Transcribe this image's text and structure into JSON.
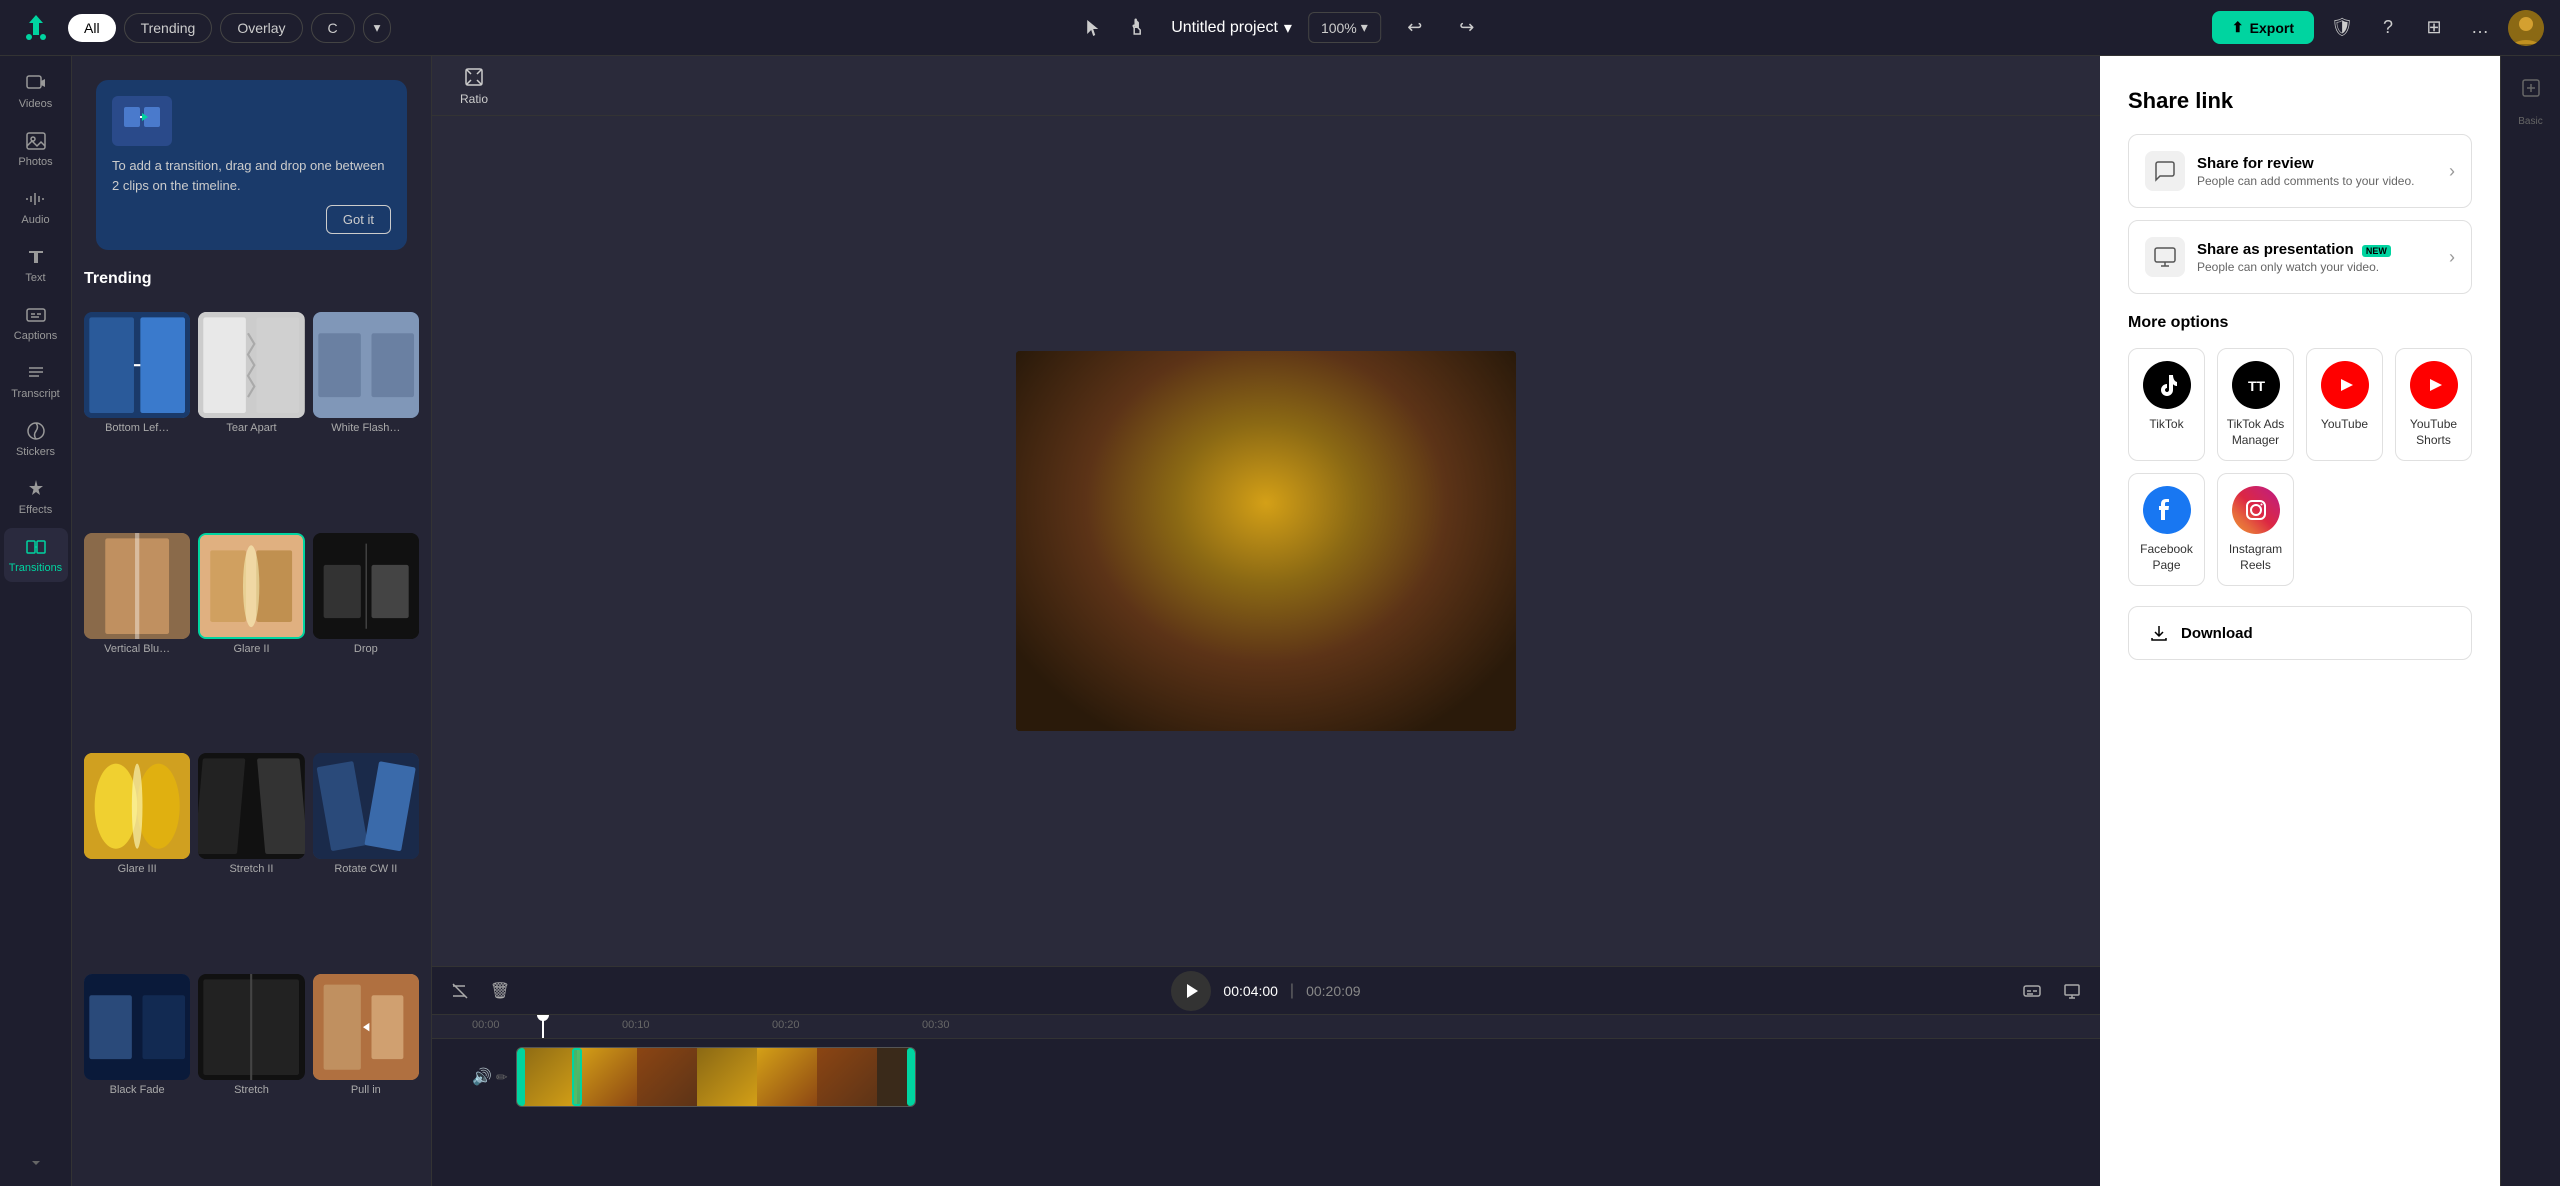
{
  "header": {
    "logo": "✂",
    "filters": {
      "all_label": "All",
      "trending_label": "Trending",
      "overlay_label": "Overlay",
      "c_label": "C",
      "dropdown_label": "▾"
    },
    "project_title": "Untitled project",
    "project_dropdown": "▾",
    "zoom_level": "100%",
    "zoom_dropdown": "▾",
    "undo_label": "↩",
    "redo_label": "↪",
    "export_label": "Export",
    "export_icon": "⬆",
    "shield_icon": "🛡",
    "question_icon": "?",
    "grid_icon": "⊞",
    "more_icon": "…"
  },
  "sidebar": {
    "items": [
      {
        "id": "videos",
        "icon": "▶",
        "label": "Videos"
      },
      {
        "id": "photos",
        "icon": "🖼",
        "label": "Photos"
      },
      {
        "id": "audio",
        "icon": "♪",
        "label": "Audio"
      },
      {
        "id": "text",
        "icon": "T",
        "label": "Text"
      },
      {
        "id": "captions",
        "icon": "CC",
        "label": "Captions"
      },
      {
        "id": "transcript",
        "icon": "≡",
        "label": "Transcript"
      },
      {
        "id": "stickers",
        "icon": "★",
        "label": "Stickers"
      },
      {
        "id": "effects",
        "icon": "✦",
        "label": "Effects"
      },
      {
        "id": "transitions",
        "icon": "⇄",
        "label": "Transitions"
      }
    ]
  },
  "transitions_panel": {
    "tooltip": {
      "text": "To add a transition, drag and drop one between 2 clips on the timeline.",
      "got_it_label": "Got it"
    },
    "section_title": "Trending",
    "items": [
      {
        "id": "bottom-left",
        "label": "Bottom Lef…",
        "selected": false
      },
      {
        "id": "tear-apart",
        "label": "Tear Apart",
        "selected": false
      },
      {
        "id": "white-flash",
        "label": "White Flash…",
        "selected": false
      },
      {
        "id": "vertical-blur",
        "label": "Vertical Blu…",
        "selected": false
      },
      {
        "id": "glare-ii",
        "label": "Glare II",
        "selected": true
      },
      {
        "id": "drop",
        "label": "Drop",
        "selected": false
      },
      {
        "id": "glare-iii",
        "label": "Glare III",
        "selected": false
      },
      {
        "id": "stretch-ii",
        "label": "Stretch II",
        "selected": false
      },
      {
        "id": "rotate-cw-ii",
        "label": "Rotate CW II",
        "selected": false
      },
      {
        "id": "black-fade",
        "label": "Black Fade",
        "selected": false
      },
      {
        "id": "stretch",
        "label": "Stretch",
        "selected": false
      },
      {
        "id": "pull-in",
        "label": "Pull in",
        "selected": false
      }
    ]
  },
  "canvas": {
    "ratio_label": "Ratio",
    "ratio_icon": "⊡"
  },
  "timeline": {
    "play_icon": "▶",
    "current_time": "00:04:00",
    "total_time": "00:20:09",
    "marks": [
      "00:00",
      "00:10",
      "00:20",
      "00:30"
    ],
    "mark_positions": [
      "40px",
      "180px",
      "320px",
      "460px"
    ],
    "delete_icon": "🗑",
    "trim_icon": "⊠",
    "volume_icon": "🔊",
    "pencil_icon": "✏"
  },
  "share_panel": {
    "title": "Share link",
    "review_option": {
      "title": "Share for review",
      "description": "People can add comments to your video.",
      "icon": "💬"
    },
    "presentation_option": {
      "title": "Share as presentation",
      "is_new": true,
      "new_label": "NEW",
      "description": "People can only watch your video.",
      "icon": "📺"
    },
    "more_options_title": "More options",
    "platforms": [
      {
        "id": "tiktok",
        "name": "TikTok",
        "icon": "🎵",
        "bg": "#000"
      },
      {
        "id": "tiktok-ads",
        "name": "TikTok Ads Manager",
        "icon": "T",
        "bg": "#000"
      },
      {
        "id": "youtube",
        "name": "YouTube",
        "icon": "▶",
        "bg": "#FF0000"
      },
      {
        "id": "youtube-shorts",
        "name": "YouTube Shorts",
        "icon": "▶",
        "bg": "#FF0000"
      },
      {
        "id": "facebook",
        "name": "Facebook Page",
        "icon": "f",
        "bg": "#1877F2"
      },
      {
        "id": "instagram",
        "name": "Instagram Reels",
        "icon": "📷",
        "bg": "#E1306C"
      }
    ],
    "download_label": "Download",
    "download_icon": "⬇"
  },
  "right_panel": {
    "basic_label": "Basic",
    "basic_icon": "⊟"
  }
}
